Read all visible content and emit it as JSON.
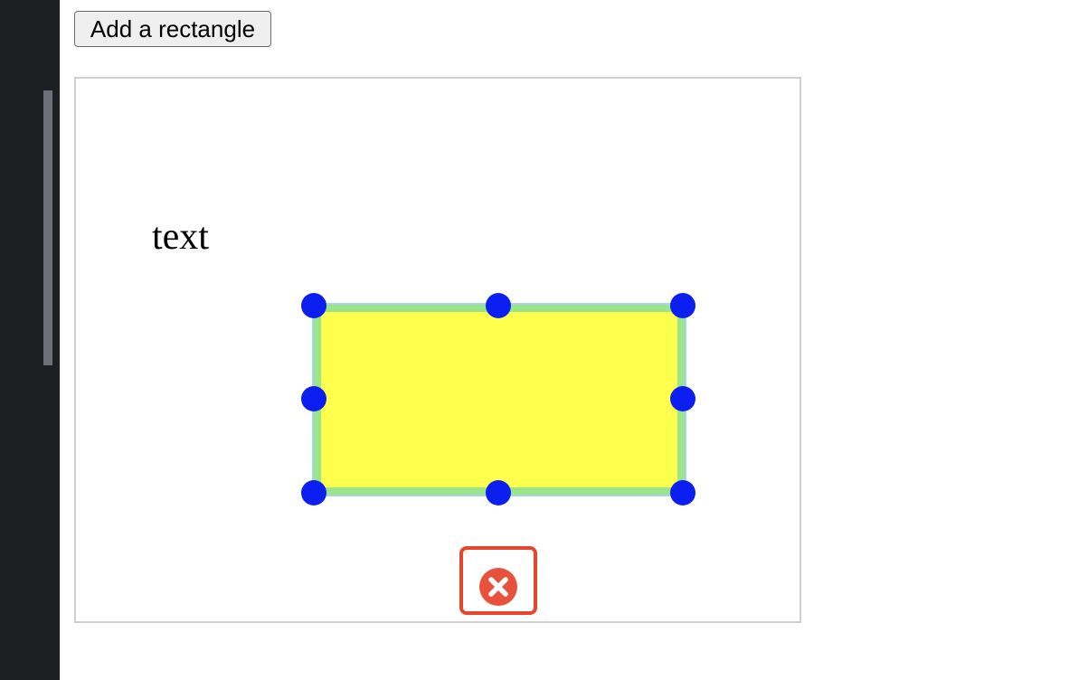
{
  "toolbar": {
    "add_rectangle_label": "Add a rectangle"
  },
  "canvas": {
    "text_label": "text",
    "rectangle": {
      "fill_color": "#ffff4e",
      "stroke_color": "#99e68a",
      "selection_outline_color": "#a8d4ea",
      "selected": true
    },
    "resize_handles": {
      "color": "#0a1ff0",
      "names": [
        "top-left",
        "top",
        "top-right",
        "left",
        "right",
        "bottom-left",
        "bottom",
        "bottom-right"
      ]
    },
    "delete_control": {
      "icon": "close-circle-icon",
      "color": "#e8452d"
    }
  }
}
